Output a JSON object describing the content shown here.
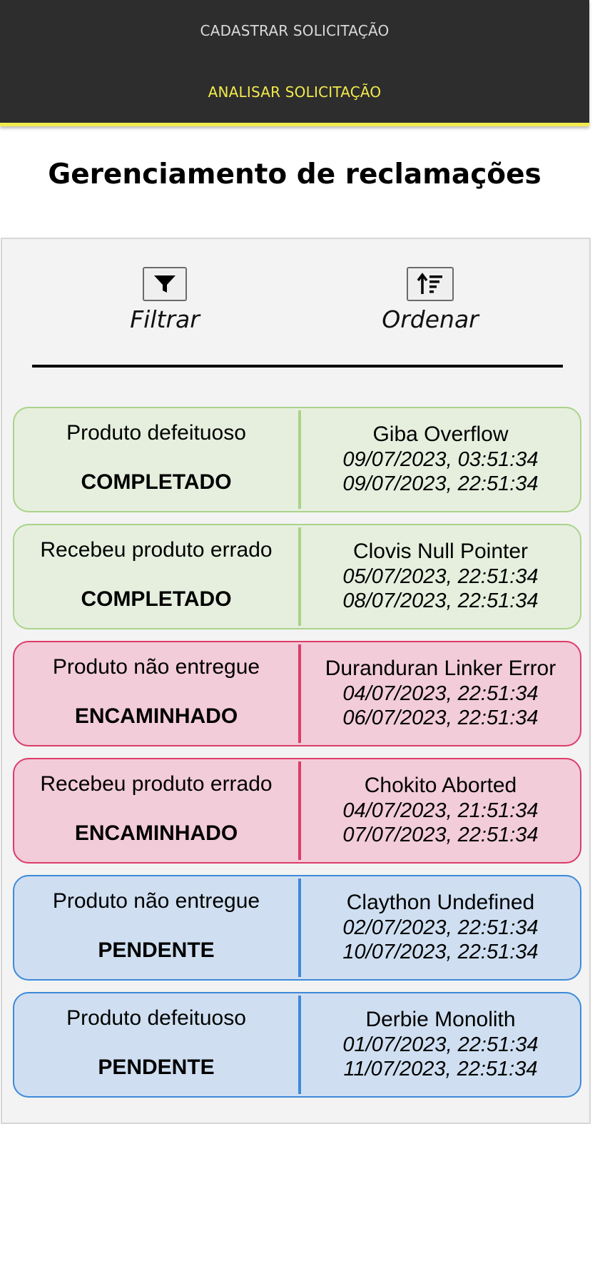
{
  "nav": {
    "items": [
      {
        "label": "CADASTRAR SOLICITAÇÃO",
        "active": false
      },
      {
        "label": "ANALISAR SOLICITAÇÃO",
        "active": true
      }
    ],
    "accent_color": "#f2ea4d",
    "background_color": "#2d2d2d"
  },
  "page": {
    "title": "Gerenciamento de reclamações"
  },
  "toolbar": {
    "filter": {
      "label": "Filtrar",
      "icon": "funnel-icon"
    },
    "sort": {
      "label": "Ordenar",
      "icon": "sort-ascending-icon"
    }
  },
  "status_colors": {
    "COMPLETADO": "#a9d38a",
    "ENCAMINHADO": "#dc3c6b",
    "PENDENTE": "#3f8ad9"
  },
  "requests": [
    {
      "reason": "Produto defeituoso",
      "status": "COMPLETADO",
      "client": "Giba Overflow",
      "date_1": "09/07/2023, 03:51:34",
      "date_2": "09/07/2023, 22:51:34"
    },
    {
      "reason": "Recebeu produto errado",
      "status": "COMPLETADO",
      "client": "Clovis Null Pointer",
      "date_1": "05/07/2023, 22:51:34",
      "date_2": "08/07/2023, 22:51:34"
    },
    {
      "reason": "Produto não entregue",
      "status": "ENCAMINHADO",
      "client": "Duranduran Linker Error",
      "date_1": "04/07/2023, 22:51:34",
      "date_2": "06/07/2023, 22:51:34"
    },
    {
      "reason": "Recebeu produto errado",
      "status": "ENCAMINHADO",
      "client": "Chokito Aborted",
      "date_1": "04/07/2023, 21:51:34",
      "date_2": "07/07/2023, 22:51:34"
    },
    {
      "reason": "Produto não entregue",
      "status": "PENDENTE",
      "client": "Claython Undefined",
      "date_1": "02/07/2023, 22:51:34",
      "date_2": "10/07/2023, 22:51:34"
    },
    {
      "reason": "Produto defeituoso",
      "status": "PENDENTE",
      "client": "Derbie Monolith",
      "date_1": "01/07/2023, 22:51:34",
      "date_2": "11/07/2023, 22:51:34"
    }
  ]
}
